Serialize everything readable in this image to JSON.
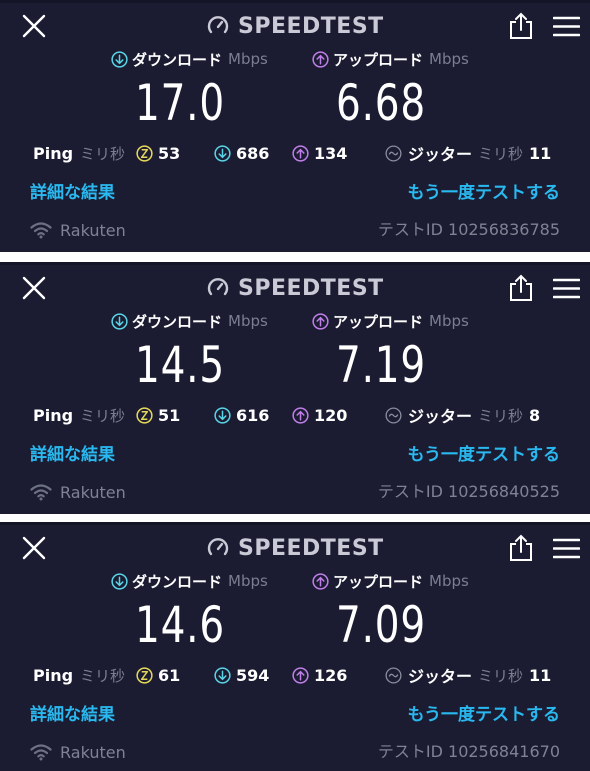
{
  "colors": {
    "background": "#1b1c31",
    "download_accent": "#59d4e6",
    "upload_accent": "#bf7ee8",
    "idle_accent": "#e6d85a",
    "link": "#29b9f0",
    "muted": "#7b7d90"
  },
  "icons": {
    "close": "close-icon",
    "speedometer": "gauge-icon",
    "share": "share-icon",
    "menu": "menu-icon",
    "download": "arrow-down-circle-icon",
    "upload": "arrow-up-circle-icon",
    "idle": "idle-ping-icon",
    "jitter": "jitter-icon",
    "wifi": "wifi-icon"
  },
  "results": [
    {
      "header": {
        "title": "SPEEDTEST"
      },
      "download": {
        "label": "ダウンロード",
        "unit": "Mbps",
        "value": "17.0"
      },
      "upload": {
        "label": "アップロード",
        "unit": "Mbps",
        "value": "6.68"
      },
      "ping": {
        "label": "Ping",
        "unit": "ミリ秒",
        "idle": "53",
        "download": "686",
        "upload": "134"
      },
      "jitter": {
        "label": "ジッター",
        "unit": "ミリ秒",
        "value": "11"
      },
      "links": {
        "details": "詳細な結果",
        "retest": "もう一度テストする"
      },
      "footer": {
        "provider": "Rakuten",
        "test_id": "テストID 10256836785"
      }
    },
    {
      "header": {
        "title": "SPEEDTEST"
      },
      "download": {
        "label": "ダウンロード",
        "unit": "Mbps",
        "value": "14.5"
      },
      "upload": {
        "label": "アップロード",
        "unit": "Mbps",
        "value": "7.19"
      },
      "ping": {
        "label": "Ping",
        "unit": "ミリ秒",
        "idle": "51",
        "download": "616",
        "upload": "120"
      },
      "jitter": {
        "label": "ジッター",
        "unit": "ミリ秒",
        "value": "8"
      },
      "links": {
        "details": "詳細な結果",
        "retest": "もう一度テストする"
      },
      "footer": {
        "provider": "Rakuten",
        "test_id": "テストID 10256840525"
      }
    },
    {
      "header": {
        "title": "SPEEDTEST"
      },
      "download": {
        "label": "ダウンロード",
        "unit": "Mbps",
        "value": "14.6"
      },
      "upload": {
        "label": "アップロード",
        "unit": "Mbps",
        "value": "7.09"
      },
      "ping": {
        "label": "Ping",
        "unit": "ミリ秒",
        "idle": "61",
        "download": "594",
        "upload": "126"
      },
      "jitter": {
        "label": "ジッター",
        "unit": "ミリ秒",
        "value": "11"
      },
      "links": {
        "details": "詳細な結果",
        "retest": "もう一度テストする"
      },
      "footer": {
        "provider": "Rakuten",
        "test_id": "テストID 10256841670"
      }
    }
  ]
}
